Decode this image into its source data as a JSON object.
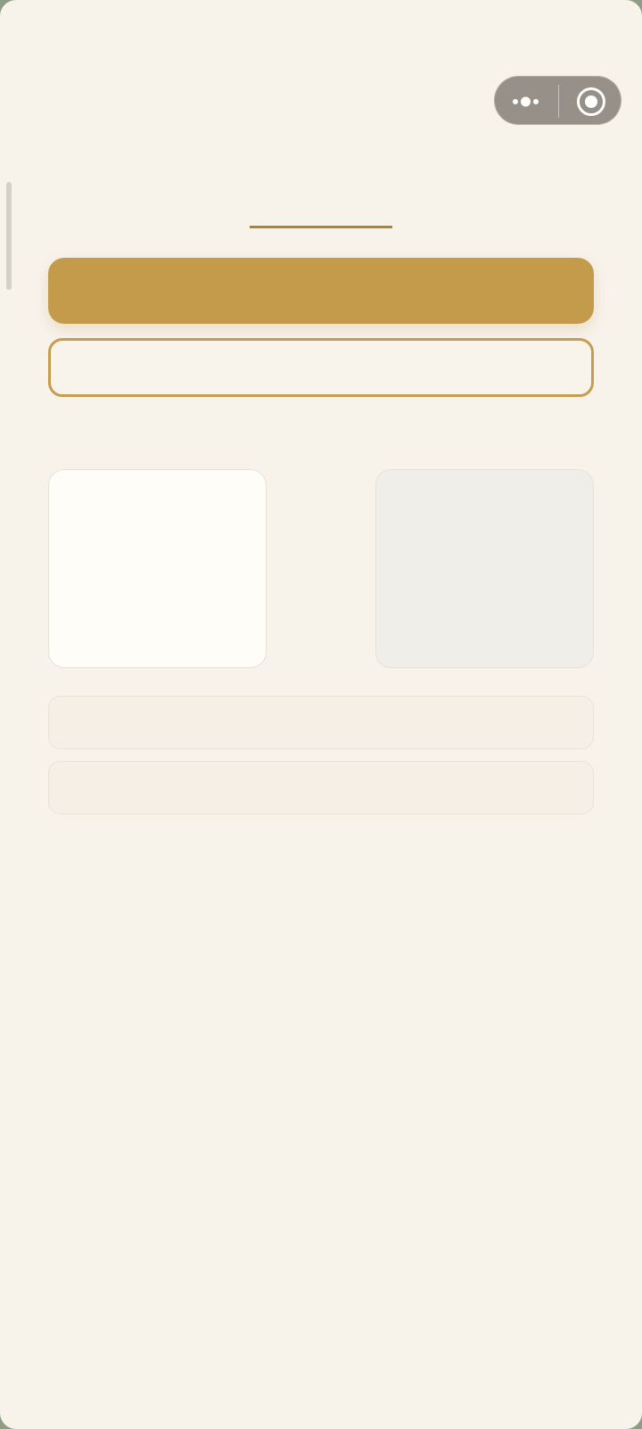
{
  "colors": {
    "page_background": "#f7f2ea",
    "accent": "#c49b4a",
    "accent_dark": "#a98632",
    "capsule": "#969088",
    "card_light": "#fffdf7",
    "card_grey": "#f0eee8",
    "row": "#f5efe5"
  },
  "capsule": {
    "more_icon": "more-dots-icon",
    "close_icon": "target-close-icon"
  },
  "title": {
    "text": ""
  },
  "primary_button": {
    "label": ""
  },
  "outline_button": {
    "label": ""
  },
  "cards": [
    {
      "label": ""
    },
    {
      "label": ""
    }
  ],
  "rows": [
    {
      "label": ""
    },
    {
      "label": ""
    }
  ]
}
